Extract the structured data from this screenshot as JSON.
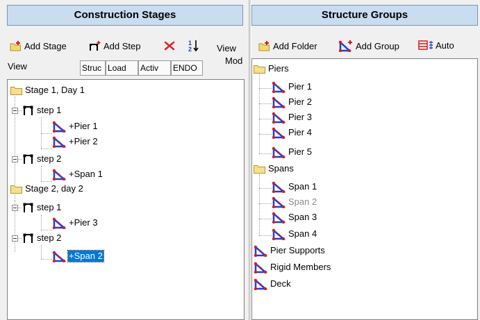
{
  "construction": {
    "title": "Construction Stages",
    "add_stage": "Add Stage",
    "add_step": "Add Step",
    "view_label": "View",
    "view_mode_label_top": "View",
    "view_mode_label_bottom": "Mod",
    "tabs": [
      "Struc",
      "Load",
      "Activ",
      "ENDO"
    ],
    "tree": {
      "stage1": "Stage 1, Day 1",
      "s1_step1": "step 1",
      "s1_step1_pier1": "+Pier 1",
      "s1_step1_pier2": "+Pier 2",
      "s1_step2": "step 2",
      "s1_step2_span1": "+Span 1",
      "stage2": "Stage 2, day 2",
      "s2_step1": "step 1",
      "s2_step1_pier3": "+Pier 3",
      "s2_step2": "step 2",
      "s2_step2_span2": "+Span 2"
    }
  },
  "structure": {
    "title": "Structure Groups",
    "add_folder": "Add Folder",
    "add_group": "Add Group",
    "auto": "Auto",
    "tree": {
      "piers": "Piers",
      "pier1": "Pier 1",
      "pier2": "Pier 2",
      "pier3": "Pier 3",
      "pier4": "Pier 4",
      "pier5": "Pier 5",
      "spans": "Spans",
      "span1": "Span 1",
      "span2": "Span 2",
      "span3": "Span 3",
      "span4": "Span 4",
      "pier_supports": "Pier Supports",
      "rigid_members": "Rigid Members",
      "deck": "Deck"
    }
  },
  "icons": {
    "folder": "folder-icon",
    "step": "step-icon",
    "group": "structure-group-icon",
    "delete": "delete-icon",
    "sort": "sort-icon",
    "auto": "auto-icon"
  },
  "colors": {
    "header_bg": "#cadcf0",
    "selection": "#0078d7",
    "group_icon_blue": "#1f3fd8",
    "group_icon_red": "#d81b1b",
    "folder_yellow": "#f6e08a"
  }
}
